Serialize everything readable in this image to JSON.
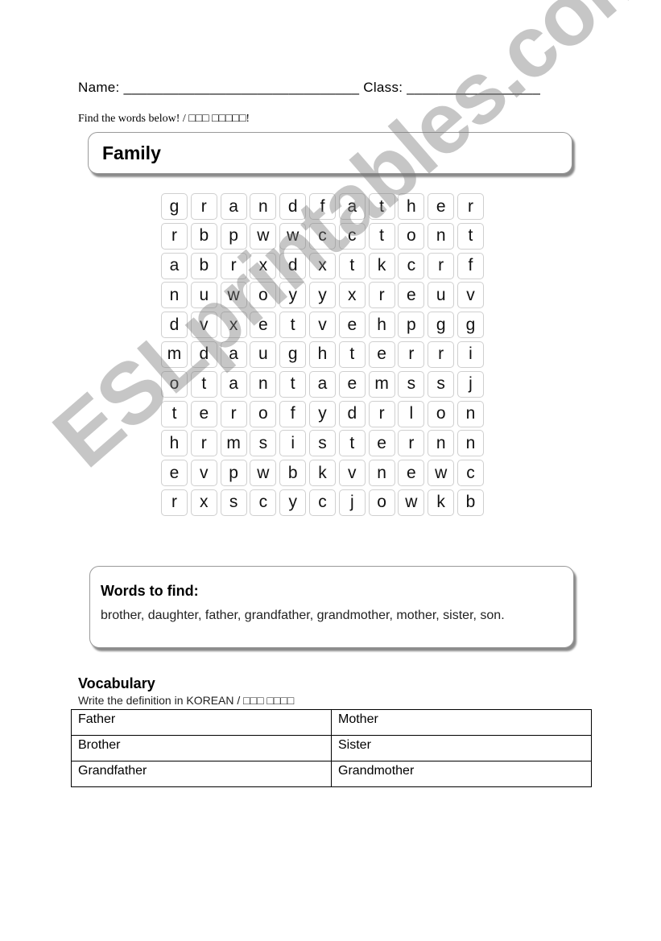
{
  "header": {
    "name_label": "Name: ______________________________ Class: _________________",
    "instruction": "Find the words below! / □□□ □□□□□!"
  },
  "puzzle": {
    "title": "Family",
    "grid": [
      [
        "g",
        "r",
        "a",
        "n",
        "d",
        "f",
        "a",
        "t",
        "h",
        "e",
        "r"
      ],
      [
        "r",
        "b",
        "p",
        "w",
        "w",
        "c",
        "c",
        "t",
        "o",
        "n",
        "t"
      ],
      [
        "a",
        "b",
        "r",
        "x",
        "d",
        "x",
        "t",
        "k",
        "c",
        "r",
        "f"
      ],
      [
        "n",
        "u",
        "w",
        "o",
        "y",
        "y",
        "x",
        "r",
        "e",
        "u",
        "v"
      ],
      [
        "d",
        "v",
        "x",
        "e",
        "t",
        "v",
        "e",
        "h",
        "p",
        "g",
        "g"
      ],
      [
        "m",
        "d",
        "a",
        "u",
        "g",
        "h",
        "t",
        "e",
        "r",
        "r",
        "i"
      ],
      [
        "o",
        "t",
        "a",
        "n",
        "t",
        "a",
        "e",
        "m",
        "s",
        "s",
        "j"
      ],
      [
        "t",
        "e",
        "r",
        "o",
        "f",
        "y",
        "d",
        "r",
        "l",
        "o",
        "n"
      ],
      [
        "h",
        "r",
        "m",
        "s",
        "i",
        "s",
        "t",
        "e",
        "r",
        "n",
        "n"
      ],
      [
        "e",
        "v",
        "p",
        "w",
        "b",
        "k",
        "v",
        "n",
        "e",
        "w",
        "c"
      ],
      [
        "r",
        "x",
        "s",
        "c",
        "y",
        "c",
        "j",
        "o",
        "w",
        "k",
        "b"
      ]
    ]
  },
  "words_to_find": {
    "title": "Words to find:",
    "list": "brother, daughter, father, grandfather, grandmother, mother, sister, son."
  },
  "vocabulary": {
    "title": "Vocabulary",
    "instruction": "Write the definition in KOREAN / □□□ □□□□",
    "rows": [
      [
        "Father",
        "Mother"
      ],
      [
        "Brother",
        "Sister"
      ],
      [
        "Grandfather",
        "Grandmother"
      ]
    ]
  },
  "watermark": "ESLprintables.com"
}
